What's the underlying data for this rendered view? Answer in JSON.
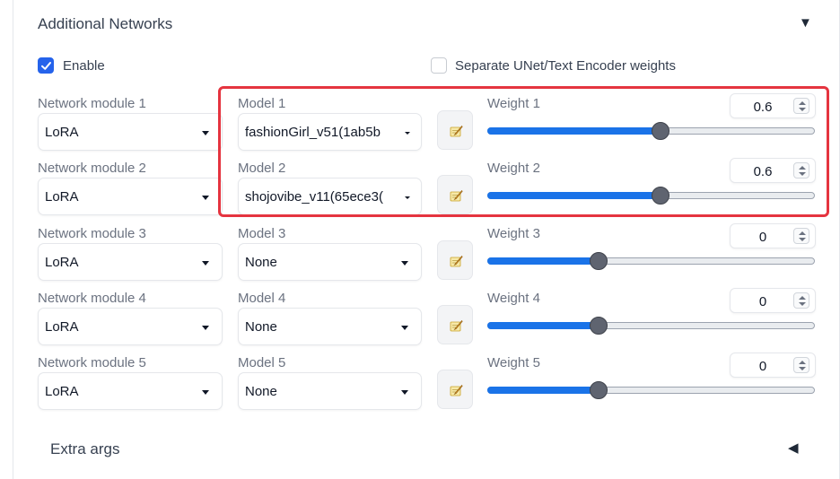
{
  "header": {
    "title": "Additional Networks",
    "collapse_glyph": "▼"
  },
  "options": {
    "enable_label": "Enable",
    "enable_checked": true,
    "separate_label": "Separate UNet/Text Encoder weights",
    "separate_checked": false
  },
  "rows": [
    {
      "module_label": "Network module 1",
      "module_value": "LoRA",
      "model_label": "Model 1",
      "model_value": "fashionGirl_v51(1ab5b",
      "weight_label": "Weight 1",
      "weight_value": "0.6",
      "weight_fraction": 0.53
    },
    {
      "module_label": "Network module 2",
      "module_value": "LoRA",
      "model_label": "Model 2",
      "model_value": "shojovibe_v11(65ece3(",
      "weight_label": "Weight 2",
      "weight_value": "0.6",
      "weight_fraction": 0.53
    },
    {
      "module_label": "Network module 3",
      "module_value": "LoRA",
      "model_label": "Model 3",
      "model_value": "None",
      "weight_label": "Weight 3",
      "weight_value": "0",
      "weight_fraction": 0.34
    },
    {
      "module_label": "Network module 4",
      "module_value": "LoRA",
      "model_label": "Model 4",
      "model_value": "None",
      "weight_label": "Weight 4",
      "weight_value": "0",
      "weight_fraction": 0.34
    },
    {
      "module_label": "Network module 5",
      "module_value": "LoRA",
      "model_label": "Model 5",
      "model_value": "None",
      "weight_label": "Weight 5",
      "weight_value": "0",
      "weight_fraction": 0.34
    }
  ],
  "edit_icon": "memo-pencil-icon",
  "extra": {
    "title": "Extra args",
    "expand_glyph": "◀"
  },
  "colors": {
    "accent": "#2563eb",
    "slider_fill": "#1a73e8",
    "highlight": "#e5343f"
  }
}
